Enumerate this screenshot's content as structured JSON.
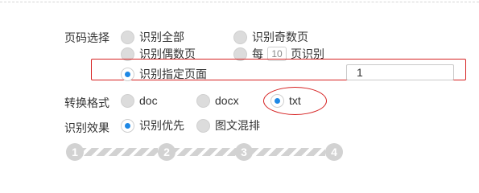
{
  "page_range": {
    "label": "页码选择",
    "options": [
      {
        "label": "识别全部",
        "checked": false
      },
      {
        "label": "识别奇数页",
        "checked": false
      },
      {
        "label": "识别偶数页",
        "checked": false
      },
      {
        "label_prefix": "每",
        "interval_value": "10",
        "label_suffix": "页识别",
        "checked": false
      },
      {
        "label": "识别指定页面",
        "checked": true
      }
    ],
    "specified_pages_value": "1"
  },
  "format": {
    "label": "转换格式",
    "options": [
      {
        "label": "doc",
        "checked": false
      },
      {
        "label": "docx",
        "checked": false
      },
      {
        "label": "txt",
        "checked": true
      }
    ]
  },
  "recognition": {
    "label": "识别效果",
    "options": [
      {
        "label": "识别优先",
        "checked": true
      },
      {
        "label": "图文混排",
        "checked": false
      }
    ]
  },
  "steps": [
    "1",
    "2",
    "3",
    "4"
  ],
  "colors": {
    "accent": "#1e88e5",
    "annotation_red": "#d62222",
    "step_gray": "#d2d2d2"
  }
}
